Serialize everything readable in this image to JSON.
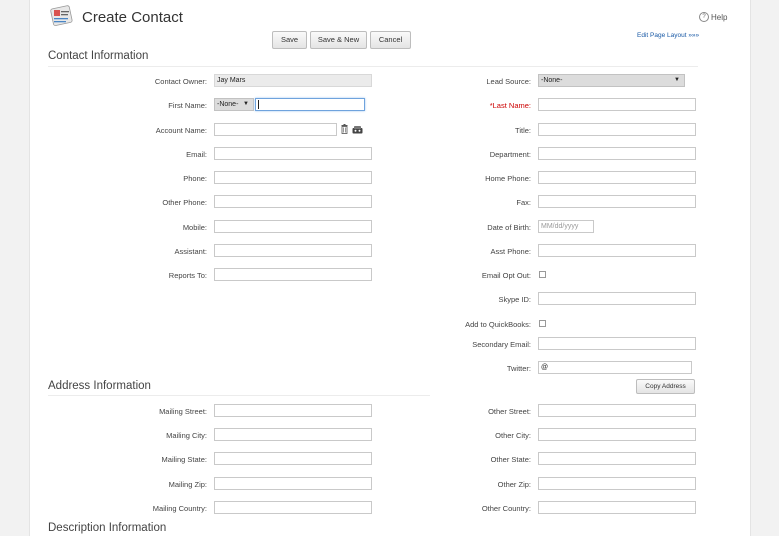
{
  "header": {
    "title": "Create Contact",
    "help": "Help",
    "edit_layout": "Edit Page Layout »»»"
  },
  "toolbar": {
    "save": "Save",
    "save_new": "Save & New",
    "cancel": "Cancel"
  },
  "sections": {
    "contact": "Contact Information",
    "address": "Address Information",
    "description": "Description Information"
  },
  "contact_left": {
    "owner_label": "Contact Owner:",
    "owner_value": "Jay Mars",
    "first_label": "First Name:",
    "salutation": "-None-",
    "account_label": "Account Name:",
    "email_label": "Email:",
    "phone_label": "Phone:",
    "other_phone_label": "Other Phone:",
    "mobile_label": "Mobile:",
    "assistant_label": "Assistant:",
    "reports_label": "Reports To:"
  },
  "contact_right": {
    "lead_source_label": "Lead Source:",
    "lead_source_value": "-None-",
    "last_name_label": "*Last Name:",
    "title_label": "Title:",
    "department_label": "Department:",
    "home_phone_label": "Home Phone:",
    "fax_label": "Fax:",
    "dob_label": "Date of Birth:",
    "dob_placeholder": "MM/dd/yyyy",
    "asst_phone_label": "Asst Phone:",
    "opt_out_label": "Email Opt Out:",
    "skype_label": "Skype ID:",
    "quickbooks_label": "Add to QuickBooks:",
    "secondary_email_label": "Secondary Email:",
    "twitter_label": "Twitter:",
    "twitter_value": "@"
  },
  "address": {
    "copy_button": "Copy Address",
    "mailing_street": "Mailing Street:",
    "mailing_city": "Mailing City:",
    "mailing_state": "Mailing State:",
    "mailing_zip": "Mailing Zip:",
    "mailing_country": "Mailing Country:",
    "other_street": "Other Street:",
    "other_city": "Other City:",
    "other_state": "Other State:",
    "other_zip": "Other Zip:",
    "other_country": "Other Country:"
  },
  "icons": {
    "logo": "contact-card-icon",
    "delete": "trash-icon",
    "lookup": "lookup-icon",
    "help": "help-circle-icon",
    "dropdown": "chevron-down-icon"
  }
}
